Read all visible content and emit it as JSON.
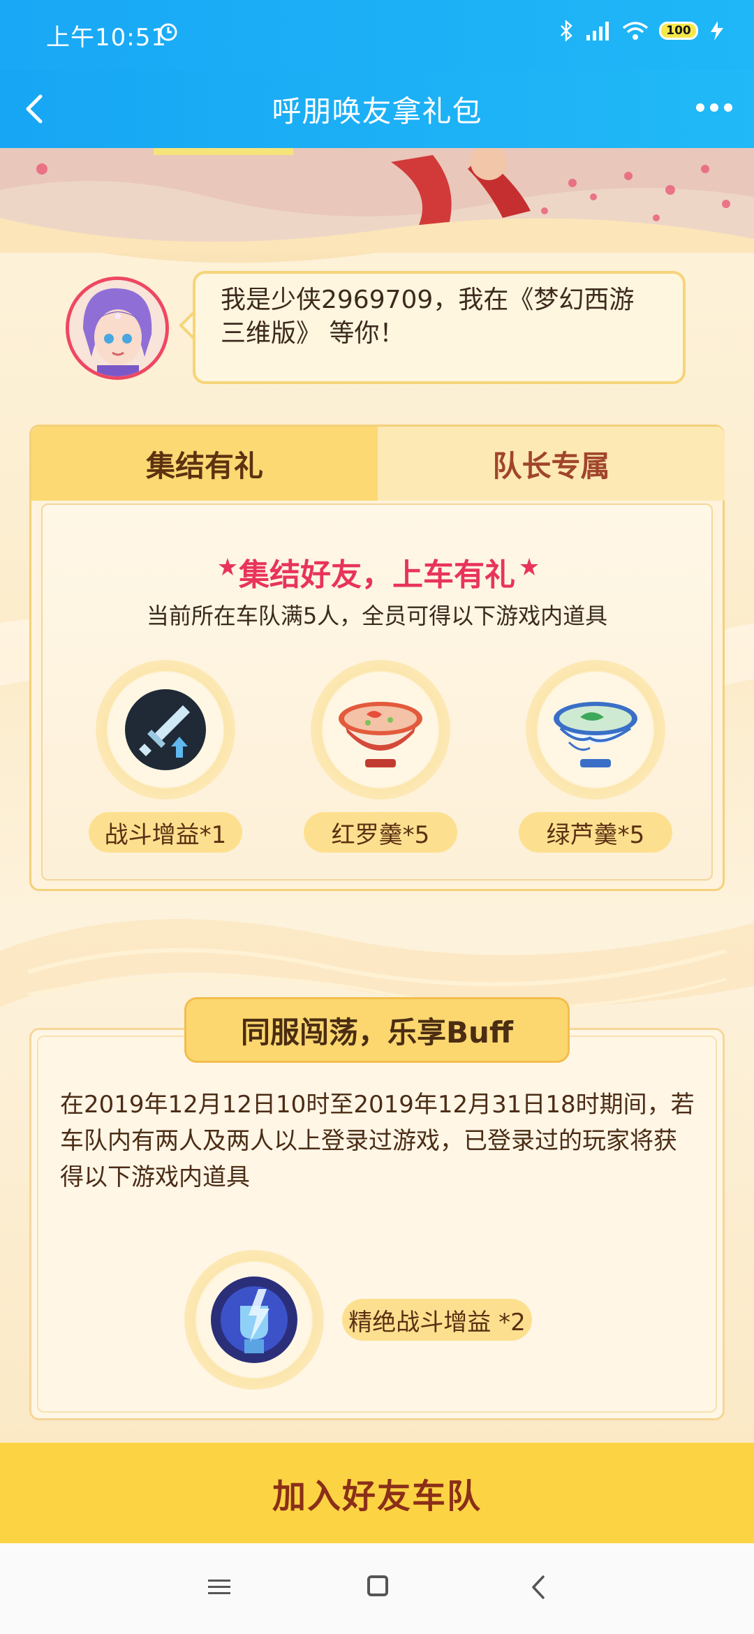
{
  "status_bar": {
    "time": "上午10:51",
    "battery": "100"
  },
  "nav": {
    "title": "呼朋唤友拿礼包"
  },
  "invite": {
    "message": "我是少侠2969709，我在《梦幻西游三维版》 等你！"
  },
  "tabs": [
    {
      "label": "集结有礼",
      "active": true
    },
    {
      "label": "队长专属",
      "active": false
    }
  ],
  "gather": {
    "title": "集结好友，上车有礼",
    "subtitle": "当前所在车队满5人，全员可得以下游戏内道具",
    "rewards": [
      {
        "label": "战斗增益*1",
        "icon": "sword-buff-icon"
      },
      {
        "label": "红罗羹*5",
        "icon": "red-soup-icon"
      },
      {
        "label": "绿芦羹*5",
        "icon": "green-soup-icon"
      }
    ]
  },
  "buff_section": {
    "title": "同服闯荡，乐享Buff",
    "description": "在2019年12月12日10时至2019年12月31日18时期间，若车队内有两人及两人以上登录过游戏，已登录过的玩家将获得以下游戏内道具",
    "reward": {
      "label": "精绝战斗增益 *2",
      "icon": "lightning-fist-icon"
    }
  },
  "join_button": {
    "label": "加入好友车队"
  },
  "colors": {
    "header": "#1fb0f6",
    "accent": "#fcd443",
    "title_red": "#e8345a"
  }
}
